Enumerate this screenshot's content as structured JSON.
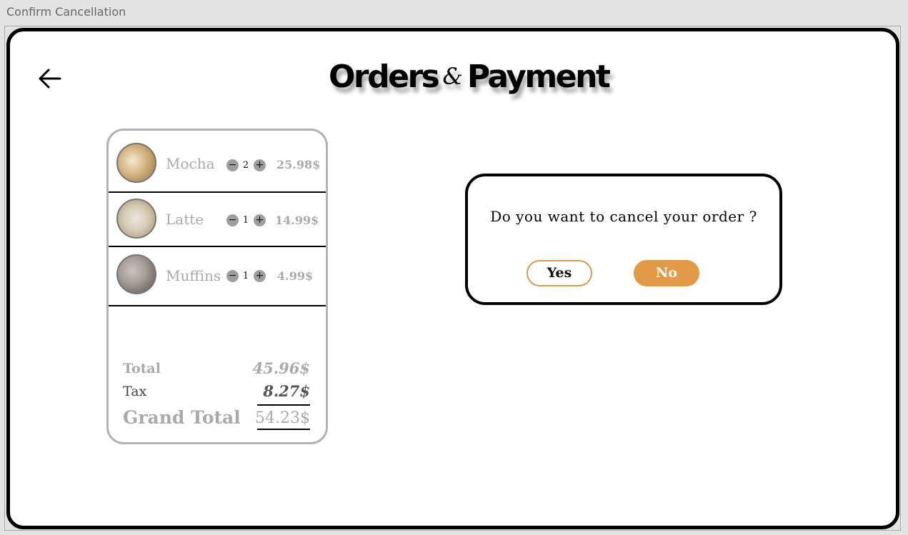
{
  "window": {
    "title": "Confirm Cancellation"
  },
  "header": {
    "title_part1": "Orders",
    "title_amp": "&",
    "title_part2": "Payment"
  },
  "order": {
    "items": [
      {
        "name": "Mocha",
        "quantity": "2",
        "price": "25.98$",
        "image": "mocha-thumbnail"
      },
      {
        "name": "Latte",
        "quantity": "1",
        "price": "14.99$",
        "image": "latte-thumbnail"
      },
      {
        "name": "Muffins",
        "quantity": "1",
        "price": "4.99$",
        "image": "muffins-thumbnail"
      }
    ],
    "summary": {
      "total_label": "Total",
      "total_value": "45.96$",
      "tax_label": "Tax",
      "tax_value": "8.27$",
      "grand_label": "Grand Total",
      "grand_value": "54.23$"
    }
  },
  "dialog": {
    "message": "Do you want to cancel your order ?",
    "yes_label": "Yes",
    "no_label": "No"
  },
  "colors": {
    "accent": "#e39a48",
    "muted_text": "#aaaaaa",
    "border": "#000000"
  },
  "icons": {
    "back": "arrow-left-icon",
    "minus": "minus-icon",
    "plus": "plus-icon"
  }
}
